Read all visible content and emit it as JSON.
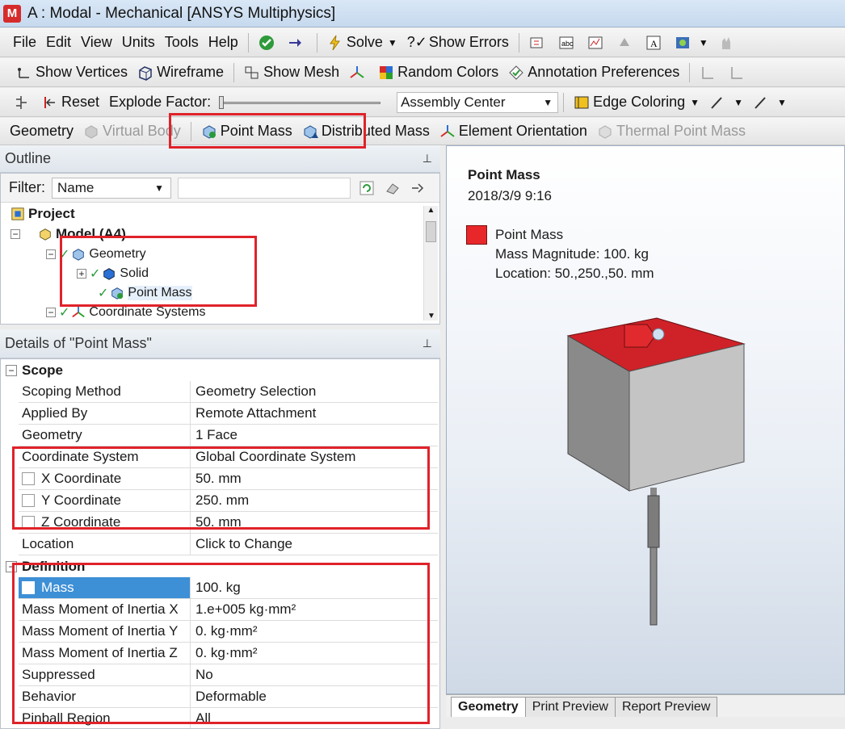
{
  "window": {
    "app_icon_letter": "M",
    "title": "A : Modal - Mechanical [ANSYS Multiphysics]"
  },
  "menu": {
    "items": [
      "File",
      "Edit",
      "View",
      "Units",
      "Tools",
      "Help"
    ],
    "solve": "Solve",
    "show_errors": "Show Errors"
  },
  "toolbar2": {
    "show_vertices": "Show Vertices",
    "wireframe": "Wireframe",
    "show_mesh": "Show Mesh",
    "random_colors": "Random Colors",
    "annotation_prefs": "Annotation Preferences"
  },
  "toolbar3": {
    "reset": "Reset",
    "explode_label": "Explode Factor:",
    "assembly": "Assembly Center",
    "edge_coloring": "Edge Coloring"
  },
  "toolbar4": {
    "geometry": "Geometry",
    "virtual_body": "Virtual Body",
    "point_mass": "Point Mass",
    "distributed_mass": "Distributed Mass",
    "element_orientation": "Element Orientation",
    "thermal_point_mass": "Thermal Point Mass"
  },
  "outline": {
    "title": "Outline",
    "filter_label": "Filter:",
    "filter_value": "Name",
    "tree": {
      "project": "Project",
      "model": "Model (A4)",
      "geometry": "Geometry",
      "solid": "Solid",
      "point_mass": "Point Mass",
      "coord_systems": "Coordinate Systems"
    }
  },
  "details": {
    "title": "Details of \"Point Mass\"",
    "scope_label": "Scope",
    "scope": [
      {
        "k": "Scoping Method",
        "v": "Geometry Selection"
      },
      {
        "k": "Applied By",
        "v": "Remote Attachment"
      },
      {
        "k": "Geometry",
        "v": "1 Face"
      },
      {
        "k": "Coordinate System",
        "v": "Global Coordinate System"
      },
      {
        "k": "X Coordinate",
        "v": "50. mm"
      },
      {
        "k": "Y Coordinate",
        "v": "250. mm"
      },
      {
        "k": "Z Coordinate",
        "v": "50. mm"
      },
      {
        "k": "Location",
        "v": "Click to Change"
      }
    ],
    "definition_label": "Definition",
    "definition": [
      {
        "k": "Mass",
        "v": "100. kg"
      },
      {
        "k": "Mass Moment of Inertia X",
        "v": "1.e+005 kg·mm²"
      },
      {
        "k": "Mass Moment of Inertia Y",
        "v": "0. kg·mm²"
      },
      {
        "k": "Mass Moment of Inertia Z",
        "v": "0. kg·mm²"
      },
      {
        "k": "Suppressed",
        "v": "No"
      },
      {
        "k": "Behavior",
        "v": "Deformable"
      },
      {
        "k": "Pinball Region",
        "v": "All"
      }
    ]
  },
  "viewport": {
    "heading": "Point Mass",
    "date": "2018/3/9 9:16",
    "legend_label": "Point Mass",
    "magnitude": "Mass Magnitude: 100. kg",
    "location": "Location: 50.,250.,50. mm",
    "legend_color": "#e8272b"
  },
  "tabs": [
    "Geometry",
    "Print Preview",
    "Report Preview"
  ]
}
